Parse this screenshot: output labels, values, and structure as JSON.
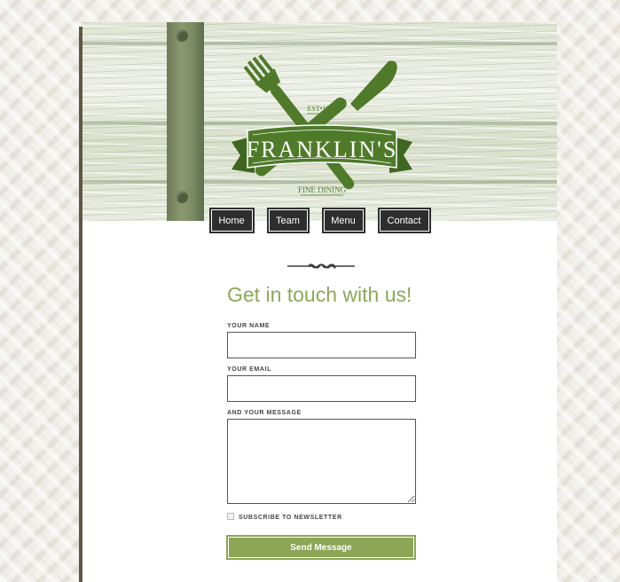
{
  "brand": {
    "name": "FRANKLIN'S",
    "established": "EST•1935",
    "tagline": "FINE DINING"
  },
  "nav": {
    "items": [
      {
        "label": "Home"
      },
      {
        "label": "Team"
      },
      {
        "label": "Menu"
      },
      {
        "label": "Contact"
      }
    ]
  },
  "contact": {
    "heading": "Get in touch with us!",
    "name_label": "YOUR NAME",
    "name_value": "",
    "email_label": "YOUR EMAIL",
    "email_value": "",
    "message_label": "AND YOUR MESSAGE",
    "message_value": "",
    "newsletter_label": "SUBSCRIBE TO NEWSLETTER",
    "newsletter_checked": false,
    "send_label": "Send Message"
  },
  "theme": {
    "accent": "#8da858",
    "logo_green": "#4f7a2a",
    "nav_bg": "#2e2e2e",
    "border": "#5d5746"
  },
  "icons": {
    "fork": "fork-icon",
    "knife": "knife-icon",
    "divider": "ornament-divider"
  }
}
